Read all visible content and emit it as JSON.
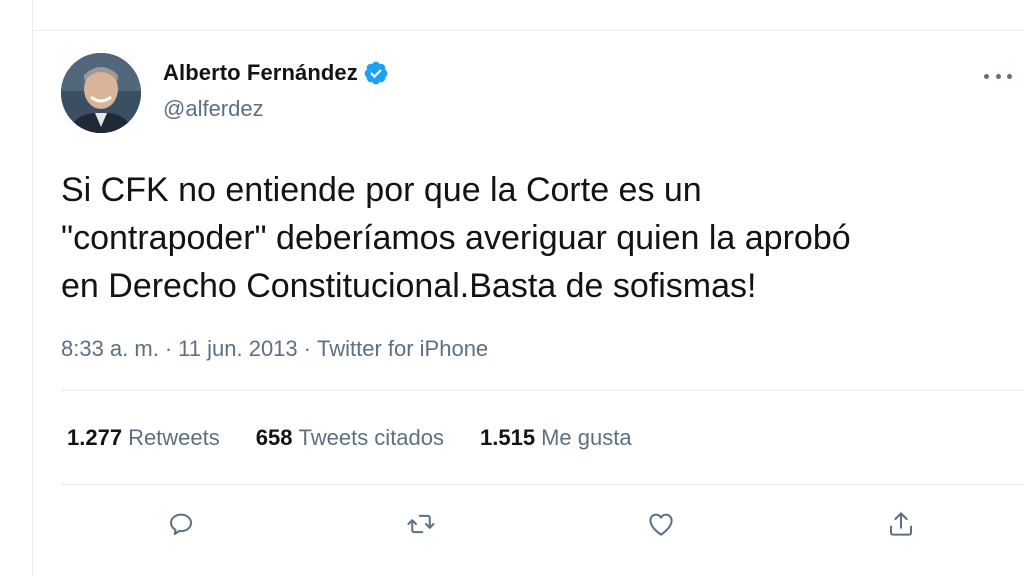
{
  "tweet": {
    "author": {
      "display_name": "Alberto Fernández",
      "handle": "@alferdez",
      "verified": true
    },
    "text_lines": [
      "Si CFK no entiende por que la Corte es un",
      "\"contrapoder\" deberíamos averiguar quien la aprobó",
      "en Derecho Constitucional.Basta de sofismas!"
    ],
    "meta": {
      "time": "8:33 a. m.",
      "separator": "·",
      "date": "11 jun. 2013",
      "source": "Twitter for iPhone"
    },
    "stats": {
      "retweets": {
        "count": "1.277",
        "label": "Retweets"
      },
      "quotes": {
        "count": "658",
        "label": "Tweets citados"
      },
      "likes": {
        "count": "1.515",
        "label": "Me gusta"
      }
    }
  },
  "icons": {
    "verified": "verified-badge-icon",
    "more": "more-options-icon",
    "reply": "reply-icon",
    "retweet": "retweet-icon",
    "like": "heart-icon",
    "share": "share-icon"
  },
  "colors": {
    "accent": "#1da1f2",
    "secondary_text": "#5b7083",
    "primary_text": "#0f1419",
    "divider": "#e6ecf0"
  }
}
